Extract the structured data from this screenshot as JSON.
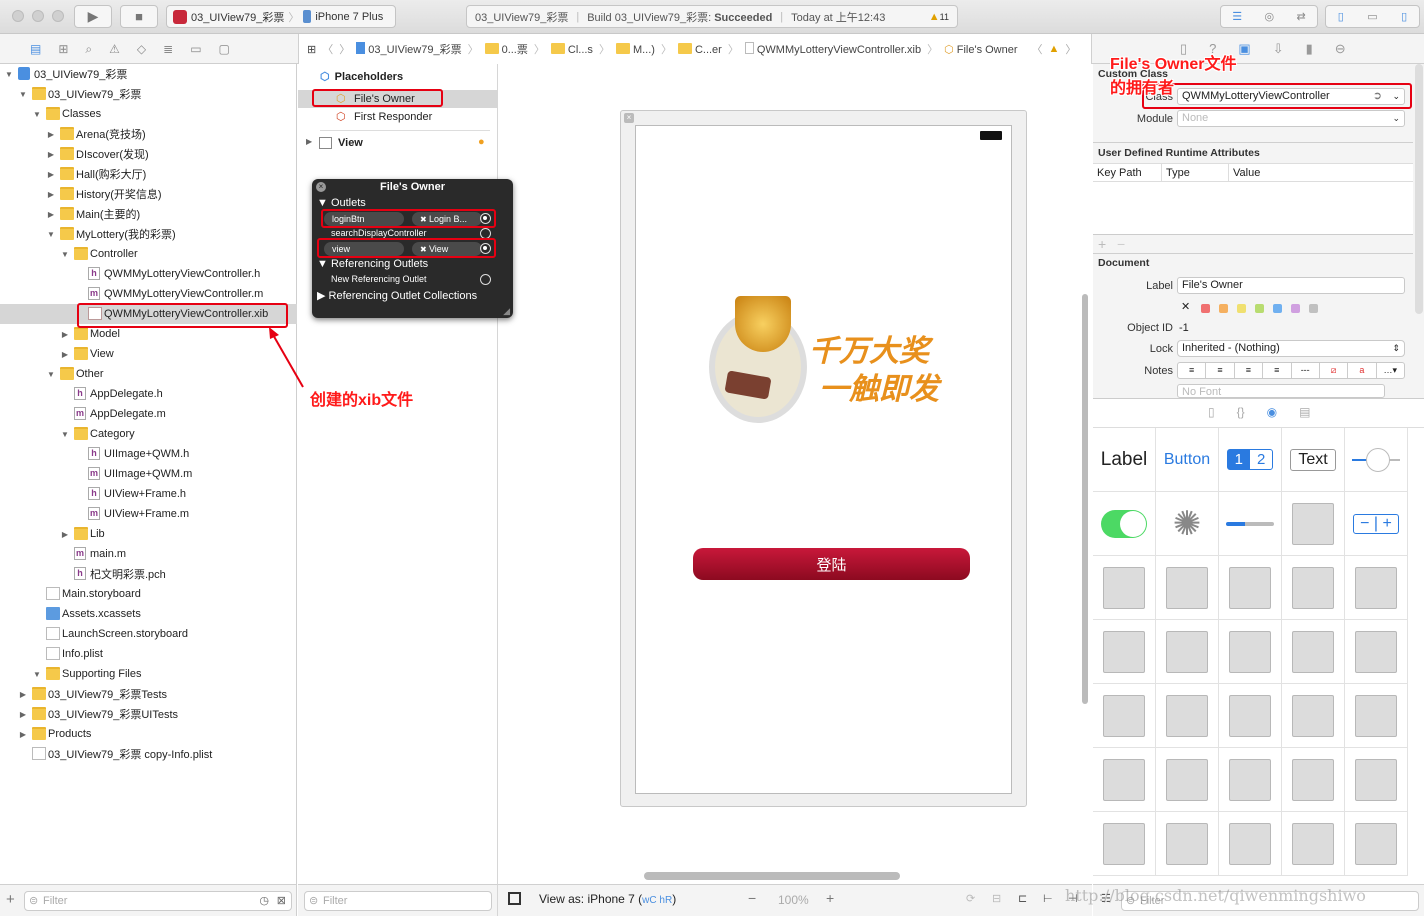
{
  "toolbar": {
    "scheme": "03_UIView79_彩票",
    "device": "iPhone 7 Plus",
    "status_project": "03_UIView79_彩票",
    "status_build": "Build 03_UIView79_彩票: ",
    "status_result": "Succeeded",
    "status_time": "Today at 上午12:43",
    "warning_count": "11"
  },
  "jumpbar": {
    "items": [
      "03_UIView79_彩票",
      "0...票",
      "Cl...s",
      "M...)",
      "C...er",
      "QWMMyLotteryViewController.xib",
      "File's Owner"
    ]
  },
  "navigator": {
    "rows": [
      {
        "label": "03_UIView79_彩票",
        "level": 0,
        "icon": "proj",
        "state": "open"
      },
      {
        "label": "03_UIView79_彩票",
        "level": 1,
        "icon": "folder",
        "state": "open"
      },
      {
        "label": "Classes",
        "level": 2,
        "icon": "folder",
        "state": "open"
      },
      {
        "label": "Arena(竞技场)",
        "level": 3,
        "icon": "folder",
        "state": "closed"
      },
      {
        "label": "DIscover(发现)",
        "level": 3,
        "icon": "folder",
        "state": "closed"
      },
      {
        "label": "Hall(购彩大厅)",
        "level": 3,
        "icon": "folder",
        "state": "closed"
      },
      {
        "label": "History(开奖信息)",
        "level": 3,
        "icon": "folder",
        "state": "closed"
      },
      {
        "label": "Main(主要的)",
        "level": 3,
        "icon": "folder",
        "state": "closed"
      },
      {
        "label": "MyLottery(我的彩票)",
        "level": 3,
        "icon": "folder",
        "state": "open"
      },
      {
        "label": "Controller",
        "level": 4,
        "icon": "folder",
        "state": "open"
      },
      {
        "label": "QWMMyLotteryViewController.h",
        "level": 5,
        "icon": "h"
      },
      {
        "label": "QWMMyLotteryViewController.m",
        "level": 5,
        "icon": "m"
      },
      {
        "label": "QWMMyLotteryViewController.xib",
        "level": 5,
        "icon": "xib",
        "selected": true
      },
      {
        "label": "Model",
        "level": 4,
        "icon": "folder",
        "state": "closed"
      },
      {
        "label": "View",
        "level": 4,
        "icon": "folder",
        "state": "closed"
      },
      {
        "label": "Other",
        "level": 3,
        "icon": "folder",
        "state": "open"
      },
      {
        "label": "AppDelegate.h",
        "level": 4,
        "icon": "h"
      },
      {
        "label": "AppDelegate.m",
        "level": 4,
        "icon": "m"
      },
      {
        "label": "Category",
        "level": 4,
        "icon": "folder",
        "state": "open"
      },
      {
        "label": "UIImage+QWM.h",
        "level": 5,
        "icon": "h"
      },
      {
        "label": "UIImage+QWM.m",
        "level": 5,
        "icon": "m"
      },
      {
        "label": "UIView+Frame.h",
        "level": 5,
        "icon": "h"
      },
      {
        "label": "UIView+Frame.m",
        "level": 5,
        "icon": "m"
      },
      {
        "label": "Lib",
        "level": 4,
        "icon": "folder",
        "state": "closed"
      },
      {
        "label": "main.m",
        "level": 4,
        "icon": "m"
      },
      {
        "label": "杞文明彩票.pch",
        "level": 4,
        "icon": "h"
      },
      {
        "label": "Main.storyboard",
        "level": 2,
        "icon": "story"
      },
      {
        "label": "Assets.xcassets",
        "level": 2,
        "icon": "assets"
      },
      {
        "label": "LaunchScreen.storyboard",
        "level": 2,
        "icon": "story"
      },
      {
        "label": "Info.plist",
        "level": 2,
        "icon": "story"
      },
      {
        "label": "Supporting Files",
        "level": 2,
        "icon": "folder",
        "state": "open"
      },
      {
        "label": "03_UIView79_彩票Tests",
        "level": 1,
        "icon": "folder",
        "state": "closed"
      },
      {
        "label": "03_UIView79_彩票UITests",
        "level": 1,
        "icon": "folder",
        "state": "closed"
      },
      {
        "label": "Products",
        "level": 1,
        "icon": "folder",
        "state": "closed"
      },
      {
        "label": "03_UIView79_彩票 copy-Info.plist",
        "level": 1,
        "icon": "story"
      }
    ],
    "filter_placeholder": "Filter"
  },
  "outline": {
    "placeholders": "Placeholders",
    "files_owner": "File's Owner",
    "first_responder": "First Responder",
    "view": "View",
    "filter_placeholder": "Filter"
  },
  "popup": {
    "title": "File's Owner",
    "outlets": "Outlets",
    "outlet1_name": "loginBtn",
    "outlet1_target": "Login B...",
    "outlet2_name": "searchDisplayController",
    "outlet3_name": "view",
    "outlet3_target": "View",
    "ref_outlets": "Referencing Outlets",
    "new_ref": "New Referencing Outlet",
    "ref_collections": "Referencing Outlet Collections"
  },
  "canvas": {
    "login_button": "登陆",
    "banner_text": [
      "千万大奖",
      "一触即发"
    ],
    "view_as": "View as: iPhone 7 (",
    "size_class": "wC hR",
    "view_as_end": ")",
    "zoom": "100%"
  },
  "inspector": {
    "custom_class": "Custom Class",
    "class_label": "Class",
    "class_value": "QWMMyLotteryViewController",
    "module_label": "Module",
    "module_placeholder": "None",
    "udra": "User Defined Runtime Attributes",
    "col_keypath": "Key Path",
    "col_type": "Type",
    "col_value": "Value",
    "document": "Document",
    "label_label": "Label",
    "label_value": "File's Owner",
    "objectid_label": "Object ID",
    "objectid_value": "-1",
    "lock_label": "Lock",
    "lock_value": "Inherited - (Nothing)",
    "notes_label": "Notes",
    "font_placeholder": "No Font",
    "colors": [
      "#f07070",
      "#f5b060",
      "#f0e070",
      "#b8dc70",
      "#70b0f0",
      "#d0a0e0",
      "#c0c0c0"
    ]
  },
  "library": {
    "label": "Label",
    "button": "Button",
    "seg1": "1",
    "seg2": "2",
    "text": "Text",
    "filter_placeholder": "Filter"
  },
  "annotations": {
    "xib_note": "创建的xib文件",
    "owner_note1": "File's Owner文件",
    "owner_note2": "的拥有者",
    "color": "#e60012"
  },
  "watermark": "http://blog.csdn.net/qiwenmingshiwo"
}
